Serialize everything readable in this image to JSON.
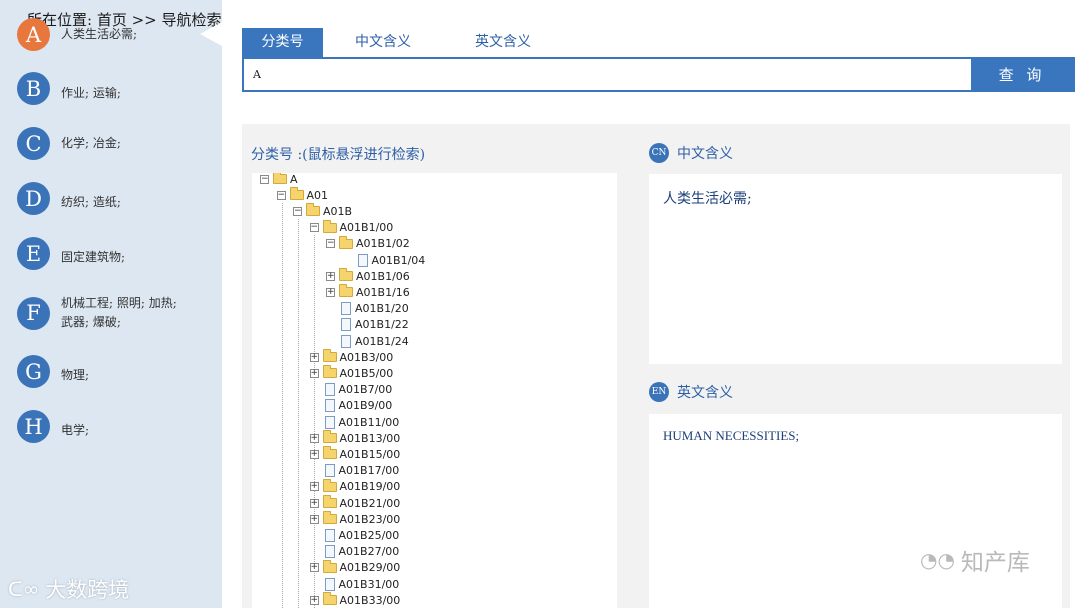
{
  "breadcrumb": "所在位置: 首页 >> 导航检索",
  "sidebar": {
    "items": [
      {
        "letter": "A",
        "label": "人类生活必需;"
      },
      {
        "letter": "B",
        "label": "作业; 运输;"
      },
      {
        "letter": "C",
        "label": "化学; 冶金;"
      },
      {
        "letter": "D",
        "label": "纺织; 造纸;"
      },
      {
        "letter": "E",
        "label": "固定建筑物;"
      },
      {
        "letter": "F",
        "label": "机械工程; 照明; 加热; 武器; 爆破;"
      },
      {
        "letter": "G",
        "label": "物理;"
      },
      {
        "letter": "H",
        "label": "电学;"
      }
    ],
    "active_letter": "A"
  },
  "tabs": [
    {
      "label": "分类号"
    },
    {
      "label": "中文含义"
    },
    {
      "label": "英文含义"
    }
  ],
  "search": {
    "value": "A",
    "button_label": "查 询"
  },
  "tree": {
    "title": "分类号 :(鼠标悬浮进行检索)",
    "nodes": [
      {
        "label": "A",
        "type": "folder",
        "expander": "−"
      },
      {
        "label": "A01",
        "type": "folder",
        "expander": "−"
      },
      {
        "label": "A01B",
        "type": "folder",
        "expander": "−"
      },
      {
        "label": "A01B1/00",
        "type": "folder",
        "expander": "−"
      },
      {
        "label": "A01B1/02",
        "type": "folder",
        "expander": "−"
      },
      {
        "label": "A01B1/04",
        "type": "doc",
        "expander": ""
      },
      {
        "label": "A01B1/06",
        "type": "folder",
        "expander": "+"
      },
      {
        "label": "A01B1/16",
        "type": "folder",
        "expander": "+"
      },
      {
        "label": "A01B1/20",
        "type": "doc",
        "expander": ""
      },
      {
        "label": "A01B1/22",
        "type": "doc",
        "expander": ""
      },
      {
        "label": "A01B1/24",
        "type": "doc",
        "expander": ""
      },
      {
        "label": "A01B3/00",
        "type": "folder",
        "expander": "+"
      },
      {
        "label": "A01B5/00",
        "type": "folder",
        "expander": "+"
      },
      {
        "label": "A01B7/00",
        "type": "doc",
        "expander": ""
      },
      {
        "label": "A01B9/00",
        "type": "doc",
        "expander": ""
      },
      {
        "label": "A01B11/00",
        "type": "doc",
        "expander": ""
      },
      {
        "label": "A01B13/00",
        "type": "folder",
        "expander": "+"
      },
      {
        "label": "A01B15/00",
        "type": "folder",
        "expander": "+"
      },
      {
        "label": "A01B17/00",
        "type": "doc",
        "expander": ""
      },
      {
        "label": "A01B19/00",
        "type": "folder",
        "expander": "+"
      },
      {
        "label": "A01B21/00",
        "type": "folder",
        "expander": "+"
      },
      {
        "label": "A01B23/00",
        "type": "folder",
        "expander": "+"
      },
      {
        "label": "A01B25/00",
        "type": "doc",
        "expander": ""
      },
      {
        "label": "A01B27/00",
        "type": "doc",
        "expander": ""
      },
      {
        "label": "A01B29/00",
        "type": "folder",
        "expander": "+"
      },
      {
        "label": "A01B31/00",
        "type": "doc",
        "expander": ""
      },
      {
        "label": "A01B33/00",
        "type": "folder",
        "expander": "+"
      }
    ]
  },
  "chinese_meaning": {
    "badge": "CN",
    "title": "中文含义",
    "text": "人类生活必需;"
  },
  "english_meaning": {
    "badge": "EN",
    "title": "英文含义",
    "text": "HUMAN NECESSITIES;"
  },
  "watermarks": {
    "left": "大数跨境",
    "right": "知产库"
  },
  "colors": {
    "primary": "#3a76bd",
    "active_badge": "#e8773e",
    "sidebar_bg": "#dde7f1"
  }
}
